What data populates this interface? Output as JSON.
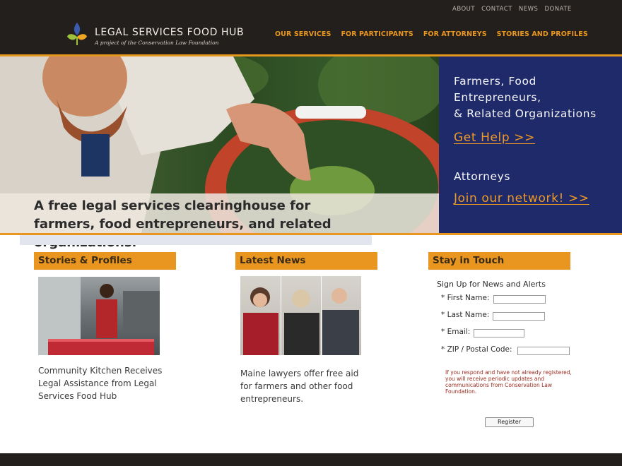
{
  "colors": {
    "header_bg": "#231f1d",
    "accent_orange": "#e8961f",
    "panel_blue": "#1f2a6b"
  },
  "utility_nav": [
    {
      "label": "ABOUT"
    },
    {
      "label": "CONTACT"
    },
    {
      "label": "NEWS"
    },
    {
      "label": "DONATE"
    }
  ],
  "brand": {
    "title": "LEGAL SERVICES FOOD HUB",
    "tagline": "A project of the Conservation Law Foundation",
    "logo_icon": "wheat-sprout-logo"
  },
  "main_nav": [
    {
      "label": "OUR SERVICES"
    },
    {
      "label": "FOR PARTICIPANTS"
    },
    {
      "label": "FOR ATTORNEYS"
    },
    {
      "label": "STORIES AND PROFILES"
    }
  ],
  "hero": {
    "caption": "A free legal services clearinghouse for farmers, food entrepreneurs, and related organizations."
  },
  "cta": {
    "heading_lines": [
      "Farmers, Food",
      "Entrepreneurs,",
      "& Related Organizations"
    ],
    "help_link": "Get Help  >>",
    "attorneys_heading": "Attorneys",
    "network_link": "Join our network!  >>"
  },
  "sections": {
    "stories": {
      "title": "Stories & Profiles",
      "story_text": "Community Kitchen Receives Legal Assistance from Legal Services Food Hub"
    },
    "news": {
      "title": "Latest News",
      "story_text": "Maine lawyers offer free aid for farmers and other food entrepreneurs."
    },
    "touch": {
      "title": "Stay in Touch",
      "form_title": "Sign Up for News and Alerts",
      "fields": [
        {
          "label": "* First Name:",
          "value": ""
        },
        {
          "label": "* Last Name:",
          "value": ""
        },
        {
          "label": "* Email:",
          "value": ""
        },
        {
          "label": "* ZIP / Postal Code:",
          "value": ""
        }
      ],
      "note": "If you respond and have not already registered, you will receive periodic updates and communications from Conservation Law Foundation.",
      "register_label": "Register"
    }
  }
}
